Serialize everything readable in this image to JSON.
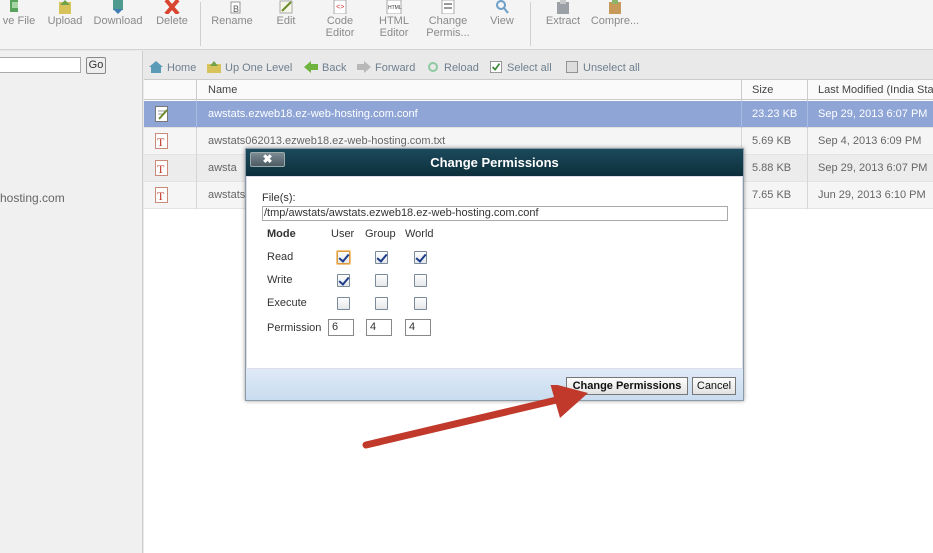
{
  "toolbar": {
    "items": [
      {
        "label": "ve File",
        "icon": "new-file-icon"
      },
      {
        "label": "Upload",
        "icon": "upload-icon"
      },
      {
        "label": "Download",
        "icon": "download-icon"
      },
      {
        "label": "Delete",
        "icon": "delete-icon"
      },
      {
        "label": "Rename",
        "icon": "rename-icon"
      },
      {
        "label": "Edit",
        "icon": "edit-icon"
      },
      {
        "label": "Code Editor",
        "icon": "code-editor-icon"
      },
      {
        "label": "HTML Editor",
        "icon": "html-editor-icon"
      },
      {
        "label": "Change Permis...",
        "icon": "change-permissions-icon"
      },
      {
        "label": "View",
        "icon": "view-icon"
      },
      {
        "label": "Extract",
        "icon": "extract-icon"
      },
      {
        "label": "Compre...",
        "icon": "compress-icon"
      }
    ]
  },
  "left": {
    "go_label": "Go",
    "tree_text": "hosting.com"
  },
  "nav": {
    "home": "Home",
    "up": "Up One Level",
    "back": "Back",
    "forward": "Forward",
    "reload": "Reload",
    "select_all": "Select all",
    "unselect_all": "Unselect all"
  },
  "table": {
    "headers": {
      "name": "Name",
      "size": "Size",
      "modified": "Last Modified (India Star"
    },
    "rows": [
      {
        "name": "awstats.ezweb18.ez-web-hosting.com.conf",
        "size": "23.23 KB",
        "modified": "Sep 29, 2013 6:07 PM",
        "icon": "conf-file-icon"
      },
      {
        "name": "awstats062013.ezweb18.ez-web-hosting.com.txt",
        "size": "5.69 KB",
        "modified": "Sep 4, 2013 6:09 PM",
        "icon": "text-file-icon"
      },
      {
        "name": "awsta",
        "size": "5.88 KB",
        "modified": "Sep 29, 2013 6:07 PM",
        "icon": "text-file-icon"
      },
      {
        "name": "awstats",
        "size": "7.65 KB",
        "modified": "Jun 29, 2013 6:10 PM",
        "icon": "text-file-icon"
      }
    ]
  },
  "modal": {
    "title": "Change Permissions",
    "close_label": "✖",
    "files_label": "File(s):",
    "files_value": "/tmp/awstats/awstats.ezweb18.ez-web-hosting.com.conf",
    "mode_label": "Mode",
    "user_label": "User",
    "group_label": "Group",
    "world_label": "World",
    "read_label": "Read",
    "write_label": "Write",
    "execute_label": "Execute",
    "permission_label": "Permission",
    "perm_user": "6",
    "perm_group": "4",
    "perm_world": "4",
    "submit_label": "Change Permissions",
    "cancel_label": "Cancel",
    "checks": {
      "read": [
        true,
        true,
        true
      ],
      "write": [
        true,
        false,
        false
      ],
      "execute": [
        false,
        false,
        false
      ]
    }
  },
  "colors": {
    "accent_row": "#8ea5d6",
    "modal_header": "#0d2e3b",
    "arrow": "#c0392b"
  }
}
